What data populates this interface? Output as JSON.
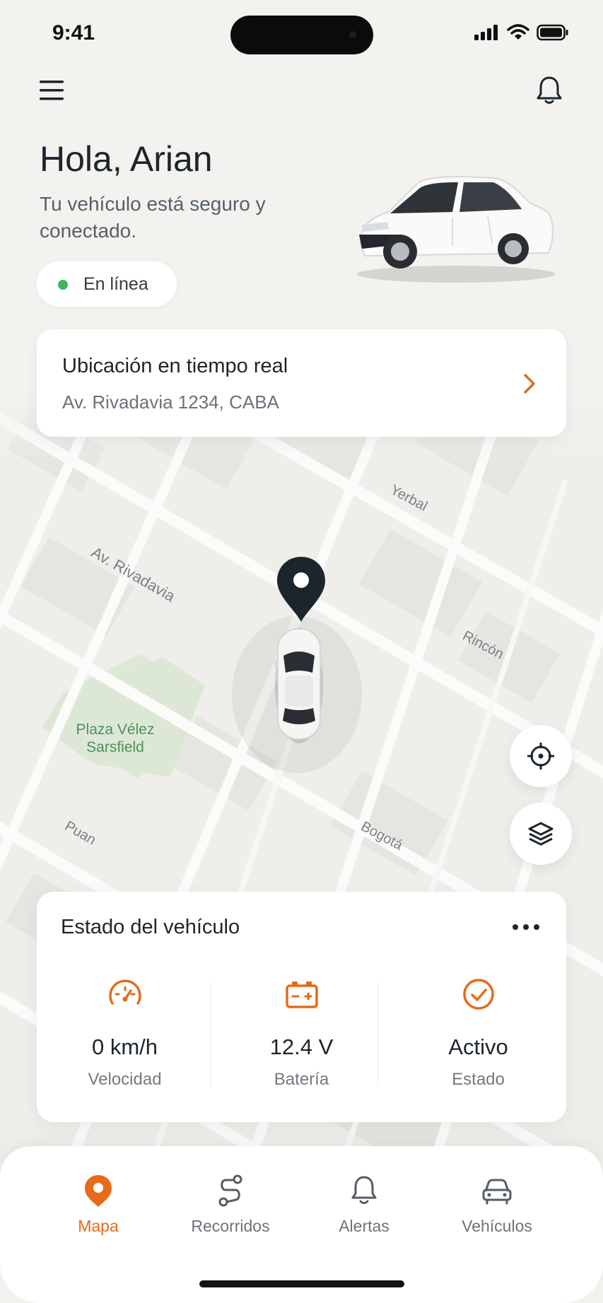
{
  "status_bar": {
    "time": "9:41"
  },
  "header": {
    "greeting": "Hola, Arian",
    "subtitle": "Tu vehículo está seguro y conectado.",
    "online_label": "En línea"
  },
  "location_card": {
    "title": "Ubicación en tiempo real",
    "address": "Av. Rivadavia 1234, CABA"
  },
  "map": {
    "streets": [
      "Yerbal",
      "Av. Rivadavia",
      "Rincón",
      "Puan",
      "Bogotá"
    ],
    "park_name": "Plaza Vélez Sarsfield"
  },
  "vehicle_status": {
    "title": "Estado del vehículo",
    "metrics": [
      {
        "value": "0 km/h",
        "label": "Velocidad",
        "icon": "speedometer-icon"
      },
      {
        "value": "12.4 V",
        "label": "Batería",
        "icon": "battery-icon"
      },
      {
        "value": "Activo",
        "label": "Estado",
        "icon": "check-circle-icon"
      }
    ]
  },
  "tabs": [
    {
      "label": "Mapa",
      "icon": "map-pin-icon",
      "active": true
    },
    {
      "label": "Recorridos",
      "icon": "route-icon",
      "active": false
    },
    {
      "label": "Alertas",
      "icon": "bell-icon",
      "active": false
    },
    {
      "label": "Vehículos",
      "icon": "car-icon",
      "active": false
    }
  ],
  "colors": {
    "accent": "#e66a1b",
    "online": "#3fb55e",
    "text_primary": "#1d252c",
    "text_secondary": "#6a727a"
  }
}
